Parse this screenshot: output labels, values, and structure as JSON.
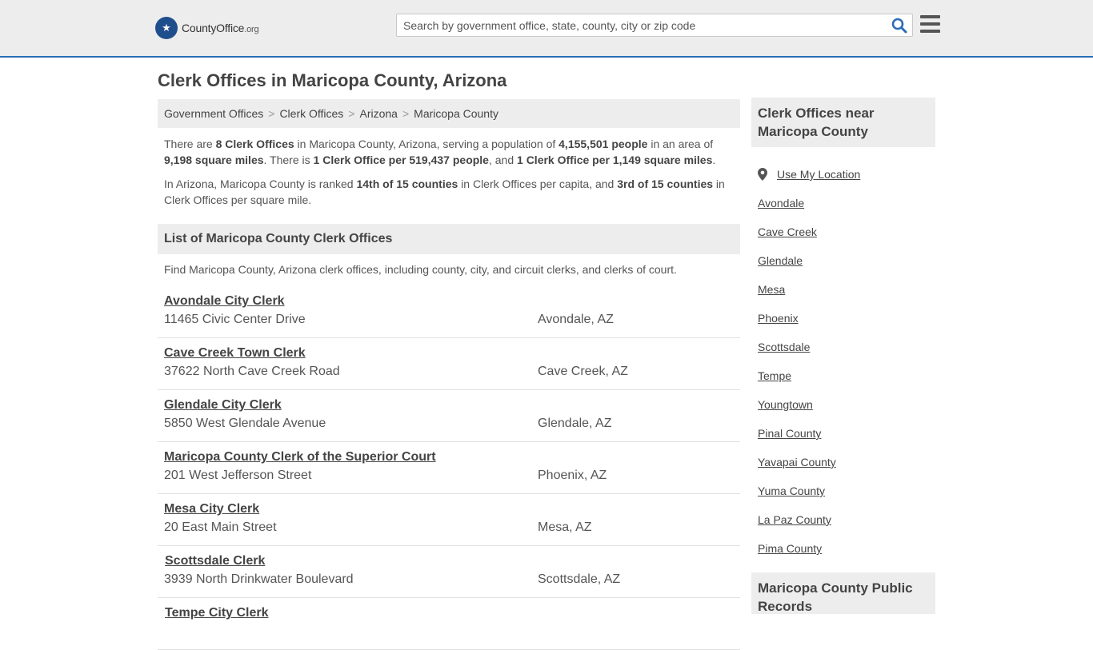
{
  "header": {
    "logo_brand": "CountyOffice",
    "logo_tld": ".org",
    "search_placeholder": "Search by government office, state, county, city or zip code"
  },
  "page_title": "Clerk Offices in Maricopa County, Arizona",
  "breadcrumb": [
    "Government Offices",
    "Clerk Offices",
    "Arizona",
    "Maricopa County"
  ],
  "summary": {
    "p1": [
      {
        "t": "There are "
      },
      {
        "t": "8 Clerk Offices",
        "b": true
      },
      {
        "t": " in Maricopa County, Arizona, serving a population of "
      },
      {
        "t": "4,155,501 people",
        "b": true
      },
      {
        "t": " in an area of "
      },
      {
        "t": "9,198 square miles",
        "b": true
      },
      {
        "t": ". There is "
      },
      {
        "t": "1 Clerk Office per 519,437 people",
        "b": true
      },
      {
        "t": ", and "
      },
      {
        "t": "1 Clerk Office per 1,149 square miles",
        "b": true
      },
      {
        "t": "."
      }
    ],
    "p2": [
      {
        "t": "In Arizona, Maricopa County is ranked "
      },
      {
        "t": "14th of 15 counties",
        "b": true
      },
      {
        "t": " in Clerk Offices per capita, and "
      },
      {
        "t": "3rd of 15 counties",
        "b": true
      },
      {
        "t": " in Clerk Offices per square mile."
      }
    ]
  },
  "list": {
    "title": "List of Maricopa County Clerk Offices",
    "description": "Find Maricopa County, Arizona clerk offices, including county, city, and circuit clerks, and clerks of court.",
    "offices": [
      {
        "name": "Avondale City Clerk",
        "address": "11465 Civic Center Drive",
        "city": "Avondale, AZ"
      },
      {
        "name": "Cave Creek Town Clerk",
        "address": "37622 North Cave Creek Road",
        "city": "Cave Creek, AZ"
      },
      {
        "name": "Glendale City Clerk",
        "address": "5850 West Glendale Avenue",
        "city": "Glendale, AZ"
      },
      {
        "name": "Maricopa County Clerk of the Superior Court",
        "address": "201 West Jefferson Street",
        "city": "Phoenix, AZ"
      },
      {
        "name": "Mesa City Clerk",
        "address": "20 East Main Street",
        "city": "Mesa, AZ"
      },
      {
        "name": "Scottsdale Clerk",
        "address": "3939 North Drinkwater Boulevard",
        "city": "Scottsdale, AZ"
      },
      {
        "name": "Tempe City Clerk",
        "address": "",
        "city": ""
      }
    ]
  },
  "sidebar": {
    "nearby_title": "Clerk Offices near Maricopa County",
    "use_location": "Use My Location",
    "links": [
      "Avondale",
      "Cave Creek",
      "Glendale",
      "Mesa",
      "Phoenix",
      "Scottsdale",
      "Tempe",
      "Youngtown",
      "Pinal County",
      "Yavapai County",
      "Yuma County",
      "La Paz County",
      "Pima County"
    ],
    "records_title": "Maricopa County Public Records"
  }
}
